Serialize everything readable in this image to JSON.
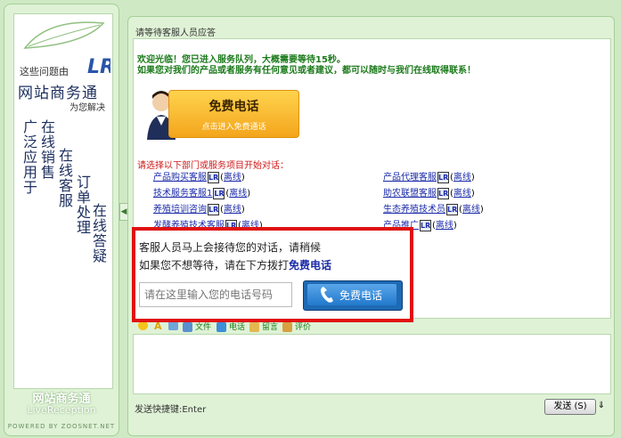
{
  "sidebar": {
    "small_text": "这些问题由",
    "title": "网站商务通",
    "subtitle": "为您解决",
    "columns": [
      "广泛应用于",
      "在线销售",
      "在线客服",
      "订单处理",
      "在线答疑"
    ],
    "bottom_title": "网站商务通",
    "bottom_sub": "LiveReception",
    "powered": "POWERED BY ZOOSNET.NET"
  },
  "main": {
    "status_label": "请等待客服人员应答",
    "welcome_line1": "欢迎光临！您已进入服务队列，大概需要等待15秒。",
    "welcome_line2": "如果您对我们的产品或者服务有任何意见或者建议，都可以随时与我们在线取得联系！",
    "call_button": {
      "label": "免费电话",
      "sub": "点击进入免费通话"
    },
    "dept_prompt": "请选择以下部门或服务项目开始对话：",
    "status_text": "离线",
    "departments_left": [
      "产品购买客服",
      "技术服务客服1",
      "养殖培训咨询",
      "发酵养殖技术客服"
    ],
    "departments_right": [
      "产品代理客服",
      "助农联盟客服",
      "生态养殖技术员",
      "产品推广"
    ]
  },
  "popup": {
    "line1": "客服人员马上会接待您的对话，请稍候",
    "line2_prefix": "如果您不想等待，请在下方拨打",
    "line2_link": "免费电话",
    "input_placeholder": "请在这里输入您的电话号码",
    "button_label": "免费电话"
  },
  "toolbar": {
    "file": "文件",
    "phone": "电话",
    "message": "留言",
    "rating": "评价"
  },
  "footer": {
    "shortcut": "发送快捷键:Enter",
    "send": "发送 (S)",
    "dropdown": "⇓"
  }
}
